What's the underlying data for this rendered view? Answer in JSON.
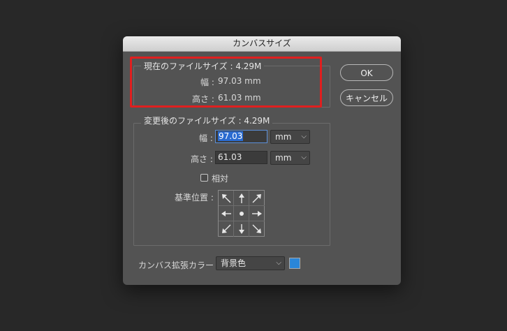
{
  "dialog": {
    "title": "カンバスサイズ"
  },
  "current": {
    "group_title": "現在のファイルサイズ : 4.29M",
    "width_label": "幅 :",
    "width_value": "97.03 mm",
    "height_label": "高さ :",
    "height_value": "61.03 mm"
  },
  "new": {
    "group_title": "変更後のファイルサイズ : 4.29M",
    "width_label": "幅 :",
    "width_value": "97.03",
    "width_unit": "mm",
    "height_label": "高さ :",
    "height_value": "61.03",
    "height_unit": "mm",
    "relative_label": "相対",
    "anchor_label": "基準位置 :"
  },
  "buttons": {
    "ok": "OK",
    "cancel": "キャンセル"
  },
  "extension": {
    "label": "カンバス拡張カラー :",
    "value": "背景色",
    "swatch_color": "#2a86d8"
  },
  "highlight_color": "#e01f1f"
}
